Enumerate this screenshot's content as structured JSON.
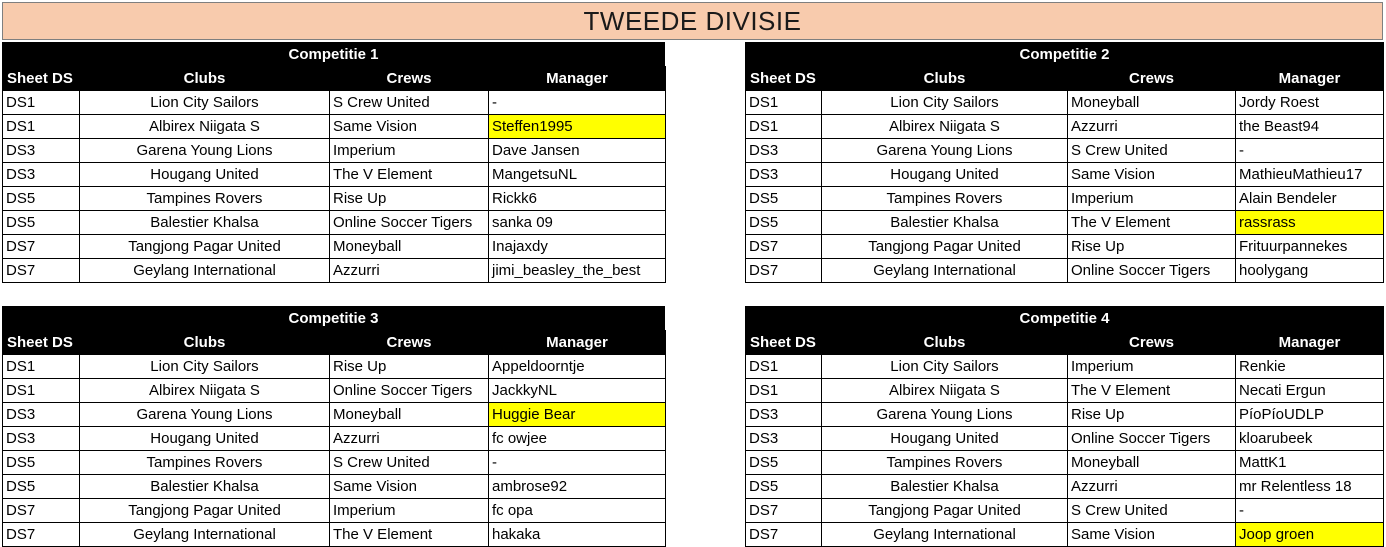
{
  "title": "TWEEDE DIVISIE",
  "highlight_color": "#ffff00",
  "header_bg": "#000000",
  "title_bg": "#f8cbad",
  "columns": [
    "Sheet DS",
    "Clubs",
    "Crews",
    "Manager"
  ],
  "competitions": [
    {
      "name": "Competitie 1",
      "rows": [
        {
          "ds": "DS1",
          "club": "Lion City Sailors",
          "crew": "S Crew United",
          "manager": "-",
          "highlight": false
        },
        {
          "ds": "DS1",
          "club": "Albirex Niigata S",
          "crew": "Same Vision",
          "manager": "Steffen1995",
          "highlight": true
        },
        {
          "ds": "DS3",
          "club": "Garena Young Lions",
          "crew": "Imperium",
          "manager": "Dave Jansen",
          "highlight": false
        },
        {
          "ds": "DS3",
          "club": "Hougang United",
          "crew": "The V Element",
          "manager": "MangetsuNL",
          "highlight": false
        },
        {
          "ds": "DS5",
          "club": "Tampines Rovers",
          "crew": "Rise Up",
          "manager": "Rickk6",
          "highlight": false
        },
        {
          "ds": "DS5",
          "club": "Balestier Khalsa",
          "crew": "Online Soccer Tigers",
          "manager": "sanka 09",
          "highlight": false
        },
        {
          "ds": "DS7",
          "club": "Tangjong Pagar United",
          "crew": "Moneyball",
          "manager": "Inajaxdy",
          "highlight": false
        },
        {
          "ds": "DS7",
          "club": "Geylang International",
          "crew": "Azzurri",
          "manager": "jimi_beasley_the_best",
          "highlight": false
        }
      ]
    },
    {
      "name": "Competitie 2",
      "rows": [
        {
          "ds": "DS1",
          "club": "Lion City Sailors",
          "crew": "Moneyball",
          "manager": "Jordy Roest",
          "highlight": false
        },
        {
          "ds": "DS1",
          "club": "Albirex Niigata S",
          "crew": "Azzurri",
          "manager": "the Beast94",
          "highlight": false
        },
        {
          "ds": "DS3",
          "club": "Garena Young Lions",
          "crew": "S Crew United",
          "manager": "-",
          "highlight": false
        },
        {
          "ds": "DS3",
          "club": "Hougang United",
          "crew": "Same Vision",
          "manager": "MathieuMathieu17",
          "highlight": false
        },
        {
          "ds": "DS5",
          "club": "Tampines Rovers",
          "crew": "Imperium",
          "manager": "Alain Bendeler",
          "highlight": false
        },
        {
          "ds": "DS5",
          "club": "Balestier Khalsa",
          "crew": "The V Element",
          "manager": "rassrass",
          "highlight": true
        },
        {
          "ds": "DS7",
          "club": "Tangjong Pagar United",
          "crew": "Rise Up",
          "manager": "Frituurpannekes",
          "highlight": false
        },
        {
          "ds": "DS7",
          "club": "Geylang International",
          "crew": "Online Soccer Tigers",
          "manager": "hoolygang",
          "highlight": false
        }
      ]
    },
    {
      "name": "Competitie 3",
      "rows": [
        {
          "ds": "DS1",
          "club": "Lion City Sailors",
          "crew": "Rise Up",
          "manager": "Appeldoorntje",
          "highlight": false
        },
        {
          "ds": "DS1",
          "club": "Albirex Niigata S",
          "crew": "Online Soccer Tigers",
          "manager": "JackkyNL",
          "highlight": false
        },
        {
          "ds": "DS3",
          "club": "Garena Young Lions",
          "crew": "Moneyball",
          "manager": "Huggie Bear",
          "highlight": true
        },
        {
          "ds": "DS3",
          "club": "Hougang United",
          "crew": "Azzurri",
          "manager": "fc owjee",
          "highlight": false
        },
        {
          "ds": "DS5",
          "club": "Tampines Rovers",
          "crew": "S Crew United",
          "manager": "-",
          "highlight": false
        },
        {
          "ds": "DS5",
          "club": "Balestier Khalsa",
          "crew": "Same Vision",
          "manager": "ambrose92",
          "highlight": false
        },
        {
          "ds": "DS7",
          "club": "Tangjong Pagar United",
          "crew": "Imperium",
          "manager": "fc opa",
          "highlight": false
        },
        {
          "ds": "DS7",
          "club": "Geylang International",
          "crew": "The V Element",
          "manager": "hakaka",
          "highlight": false
        }
      ]
    },
    {
      "name": "Competitie 4",
      "rows": [
        {
          "ds": "DS1",
          "club": "Lion City Sailors",
          "crew": "Imperium",
          "manager": "Renkie",
          "highlight": false
        },
        {
          "ds": "DS1",
          "club": "Albirex Niigata S",
          "crew": "The V Element",
          "manager": "Necati Ergun",
          "highlight": false
        },
        {
          "ds": "DS3",
          "club": "Garena Young Lions",
          "crew": "Rise Up",
          "manager": "PíoPíoUDLP",
          "highlight": false
        },
        {
          "ds": "DS3",
          "club": "Hougang United",
          "crew": "Online Soccer Tigers",
          "manager": "kloarubeek",
          "highlight": false
        },
        {
          "ds": "DS5",
          "club": "Tampines Rovers",
          "crew": "Moneyball",
          "manager": "MattK1",
          "highlight": false
        },
        {
          "ds": "DS5",
          "club": "Balestier Khalsa",
          "crew": "Azzurri",
          "manager": "mr Relentless 18",
          "highlight": false
        },
        {
          "ds": "DS7",
          "club": "Tangjong Pagar United",
          "crew": "S Crew United",
          "manager": "-",
          "highlight": false
        },
        {
          "ds": "DS7",
          "club": "Geylang International",
          "crew": "Same Vision",
          "manager": "Joop groen",
          "highlight": true
        }
      ]
    }
  ]
}
